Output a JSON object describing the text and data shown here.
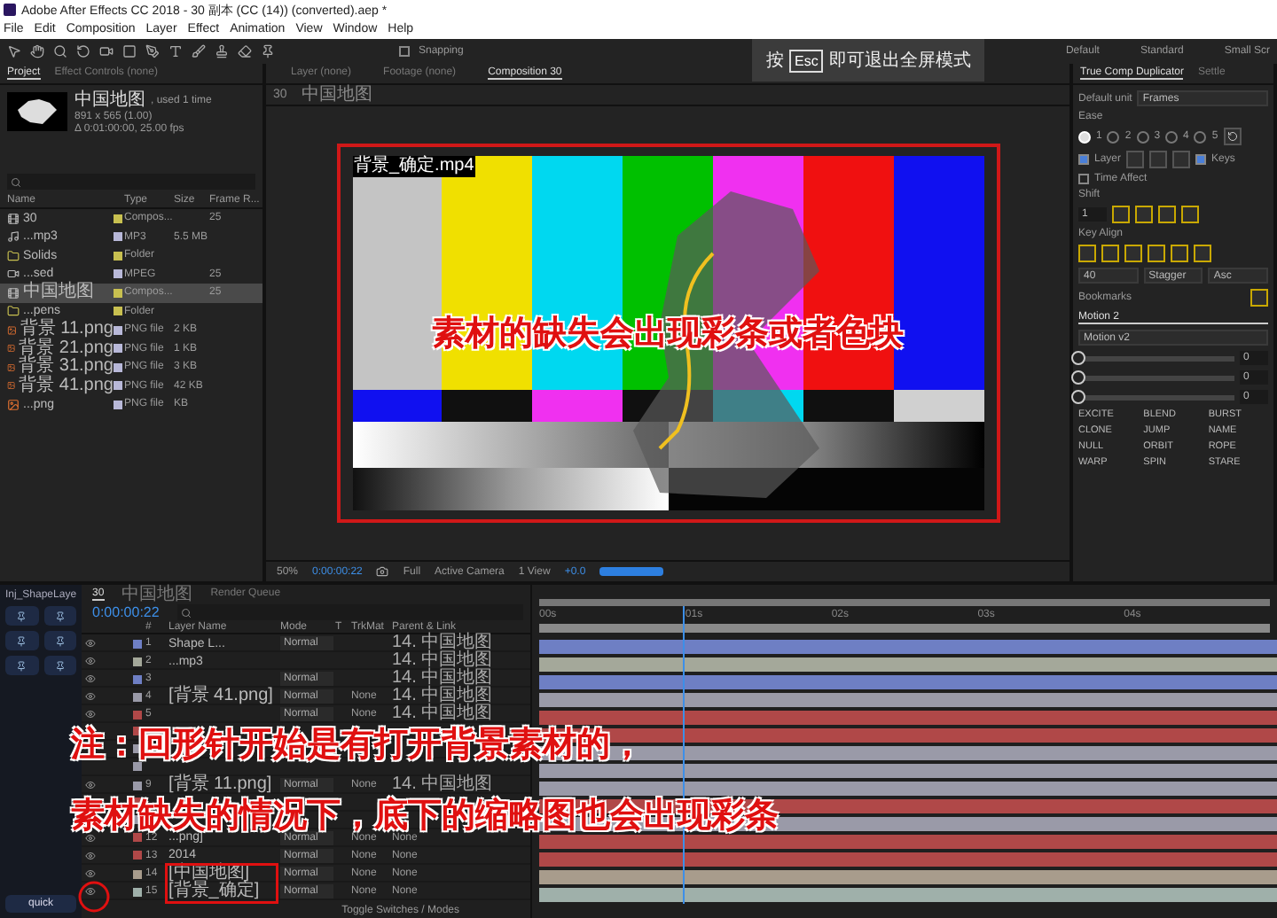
{
  "window": {
    "title": "Adobe After Effects CC 2018 - 30 副本 (CC (14)) (converted).aep *"
  },
  "menu": [
    "File",
    "Edit",
    "Composition",
    "Layer",
    "Effect",
    "Animation",
    "View",
    "Window",
    "Help"
  ],
  "toolbar": {
    "snapping": "Snapping",
    "snapping_on": false,
    "workspaces": [
      "Default",
      "Standard",
      "Small Scr"
    ]
  },
  "fullscreen_hint": {
    "prefix": "按",
    "key": "Esc",
    "suffix": "即可退出全屏模式"
  },
  "project": {
    "tabs": [
      {
        "label": "Project",
        "selected": true
      },
      {
        "label": "Effect Controls (none)",
        "selected": false
      }
    ],
    "preview": {
      "name": "中国地图",
      "usage": ", used 1 time",
      "size": "891 x 565 (1.00)",
      "duration": "Δ 0:01:00:00, 25.00 fps"
    },
    "columns": [
      "Name",
      "Type",
      "Size",
      "Frame R..."
    ],
    "items": [
      {
        "kind": "comp",
        "name": "30",
        "type": "Compos...",
        "frame_rate": "25",
        "color": "#c8c050",
        "selected": false
      },
      {
        "kind": "audio",
        "name": "...mp3",
        "type": "MP3",
        "size": "5.5 MB",
        "color": "#b8b8d8",
        "selected": false
      },
      {
        "kind": "folder",
        "name": "Solids",
        "type": "Folder",
        "color": "#c8c050",
        "selected": false
      },
      {
        "kind": "video",
        "name": "...sed",
        "type": "MPEG",
        "frame_rate": "25",
        "color": "#b8b8d8",
        "selected": false
      },
      {
        "kind": "comp",
        "name": "中国地图",
        "type": "Compos...",
        "frame_rate": "25",
        "color": "#c8c050",
        "selected": true
      },
      {
        "kind": "folder",
        "name": "...pens",
        "type": "Folder",
        "color": "#c8c050",
        "selected": false
      },
      {
        "kind": "image",
        "name": "背景 11.png",
        "type": "PNG file",
        "size": "2 KB",
        "color": "#b8b8d8",
        "selected": false
      },
      {
        "kind": "image",
        "name": "背景 21.png",
        "type": "PNG file",
        "size": "1 KB",
        "color": "#b8b8d8",
        "selected": false
      },
      {
        "kind": "image",
        "name": "背景 31.png",
        "type": "PNG file",
        "size": "3 KB",
        "color": "#b8b8d8",
        "selected": false
      },
      {
        "kind": "image",
        "name": "背景 41.png",
        "type": "PNG file",
        "size": "42 KB",
        "color": "#b8b8d8",
        "selected": false
      },
      {
        "kind": "image",
        "name": "...png",
        "type": "PNG file",
        "size": "KB",
        "color": "#b8b8d8",
        "selected": false
      }
    ]
  },
  "viewer": {
    "tabs": [
      {
        "label": "Layer (none)",
        "selected": false
      },
      {
        "label": "Footage (none)",
        "selected": false
      },
      {
        "label": "Composition 30",
        "selected": true
      }
    ],
    "breadcrumb": [
      "30",
      "中国地图"
    ],
    "layer_label": "背景_确定.mp4",
    "caption": "素材的缺失会出现彩条或者色块",
    "zoom": "50%",
    "timecode": "0:00:00:22",
    "resolution": "Full",
    "camera": "Active Camera",
    "views": "1 View",
    "exposure": "+0.0"
  },
  "right_panel": {
    "tabs": [
      {
        "label": "True Comp Duplicator",
        "selected": true
      },
      {
        "label": "Settle",
        "selected": false
      }
    ],
    "unit_label": "Default unit",
    "unit": "Frames",
    "ease_label": "Ease",
    "ease": [
      {
        "label": "1",
        "selected": true
      },
      {
        "label": "2",
        "selected": false
      },
      {
        "label": "3",
        "selected": false
      },
      {
        "label": "4",
        "selected": false
      },
      {
        "label": "5",
        "selected": false
      }
    ],
    "layer": {
      "label": "Layer",
      "checked": true
    },
    "keys": {
      "label": "Keys",
      "checked": true
    },
    "time_affect": {
      "label": "Time Affect",
      "checked": false
    },
    "shift_label": "Shift",
    "shift": "1",
    "key_align_label": "Key Align",
    "stagger": [
      "40",
      "Stagger",
      "Asc"
    ],
    "bookmarks": "Bookmarks",
    "motion_tab": "Motion 2",
    "motion_preset": "Motion v2",
    "sliders": [
      {
        "level": 0,
        "reading": "0"
      },
      {
        "level": 0,
        "reading": "0"
      },
      {
        "level": 0,
        "reading": "0"
      }
    ],
    "buttons": [
      "EXCITE",
      "BLEND",
      "BURST",
      "CLONE",
      "JUMP",
      "NAME",
      "NULL",
      "ORBIT",
      "ROPE",
      "WARP",
      "SPIN",
      "STARE"
    ]
  },
  "timeline": {
    "script_title": "Inj_ShapeLaye",
    "script_bottom": "quick",
    "tabs": [
      {
        "label": "30",
        "selected": true
      },
      {
        "label": "中国地图",
        "selected": false
      },
      {
        "label": "Render Queue",
        "selected": false
      }
    ],
    "timecode": "0:00:00:22",
    "columns": [
      "#",
      "Layer Name",
      "Mode",
      "T",
      "TrkMat",
      "Parent & Link"
    ],
    "ruler": [
      "00s",
      "01s",
      "02s",
      "03s",
      "04s"
    ],
    "playhead": {
      "level": 0.2
    },
    "layers": [
      {
        "number": "1",
        "name": "Shape L...",
        "mode": "Normal",
        "parent": "14. 中国地图",
        "color": "#6e7fc4"
      },
      {
        "number": "2",
        "name": "...mp3",
        "parent": "14. 中国地图",
        "color": "#a4a89a"
      },
      {
        "number": "3",
        "mode": "Normal",
        "parent": "14. 中国地图",
        "color": "#6e7fc4"
      },
      {
        "number": "4",
        "name": "[背景 41.png]",
        "mode": "Normal",
        "trkmat": "None",
        "parent": "14. 中国地图",
        "color": "#9a9aa8"
      },
      {
        "number": "5",
        "mode": "Normal",
        "trkmat": "None",
        "parent": "14. 中国地图",
        "color": "#b04848"
      },
      {
        "color": "#b04848"
      },
      {
        "color": "#9a9aa8"
      },
      {
        "color": "#9a9aa8"
      },
      {
        "number": "9",
        "name": "[背景 11.png]",
        "mode": "Normal",
        "trkmat": "None",
        "parent": "14. 中国地图",
        "color": "#9a9aa8"
      },
      {
        "color": "#b04848"
      },
      {
        "color": "#9a9aa8"
      },
      {
        "number": "12",
        "name": "...png]",
        "mode": "Normal",
        "trkmat": "None",
        "parent": "None",
        "color": "#b04848"
      },
      {
        "number": "13",
        "name": "2014",
        "mode": "Normal",
        "trkmat": "None",
        "parent": "None",
        "color": "#b04848"
      },
      {
        "number": "14",
        "name": "[中国地图]",
        "mode": "Normal",
        "trkmat": "None",
        "parent": "None",
        "color": "#a89c8c"
      },
      {
        "number": "15",
        "name": "[背景_确定]",
        "mode": "Normal",
        "trkmat": "None",
        "parent": "None",
        "color": "#9fb0aa"
      }
    ],
    "footer": "Toggle Switches / Modes"
  },
  "subtitles": [
    "注：回形针开始是有打开背景素材的，",
    "素材缺失的情况下，底下的缩略图也会出现彩条"
  ]
}
